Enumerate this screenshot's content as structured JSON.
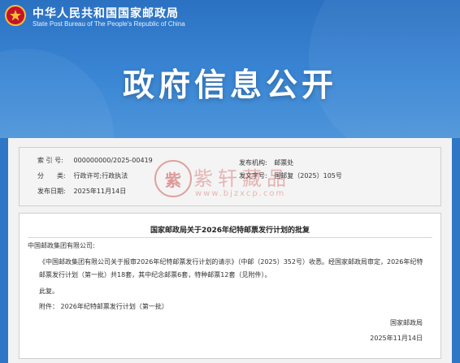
{
  "header": {
    "org_name_cn": "中华人民共和国国家邮政局",
    "org_name_en": "State Post Bureau of The People's Republic of China",
    "banner_title": "政府信息公开"
  },
  "meta": {
    "index_label": "索 引 号:",
    "index_value": "000000000/2025-00419",
    "category_label": "分　　类:",
    "category_value": "行政许可;行政执法",
    "date_label": "发布日期:",
    "date_value": "2025年11月14日",
    "issuer_label": "发布机构:",
    "issuer_value": "邮票处",
    "docno_label": "发文字号:",
    "docno_value": "国邮复（2025）105号"
  },
  "document": {
    "title": "国家邮政局关于2026年纪特邮票发行计划的批复",
    "addressee": "中国邮政集团有限公司:",
    "body_line1": "《中国邮政集团有限公司关于报审2026年纪特邮票发行计划的请示》（中邮（2025）352号）收悉。经国家邮政局审定，2026年纪特",
    "body_line2": "邮票发行计划（第一批）共18套，其中纪念邮票6套，特种邮票12套（见附件）。",
    "reply": "此复。",
    "attachment": "附件：  2026年纪特邮票发行计划（第一批）",
    "signature": "国家邮政局",
    "sign_date": "2025年11月14日"
  },
  "watermark": {
    "seal_char": "紫",
    "brand": "紫轩藏品",
    "url": "www.bjzxcp.com"
  },
  "colors": {
    "header_blue": "#2f77c6",
    "emblem_red": "#c8102e",
    "watermark_red": "#c83c3c"
  }
}
